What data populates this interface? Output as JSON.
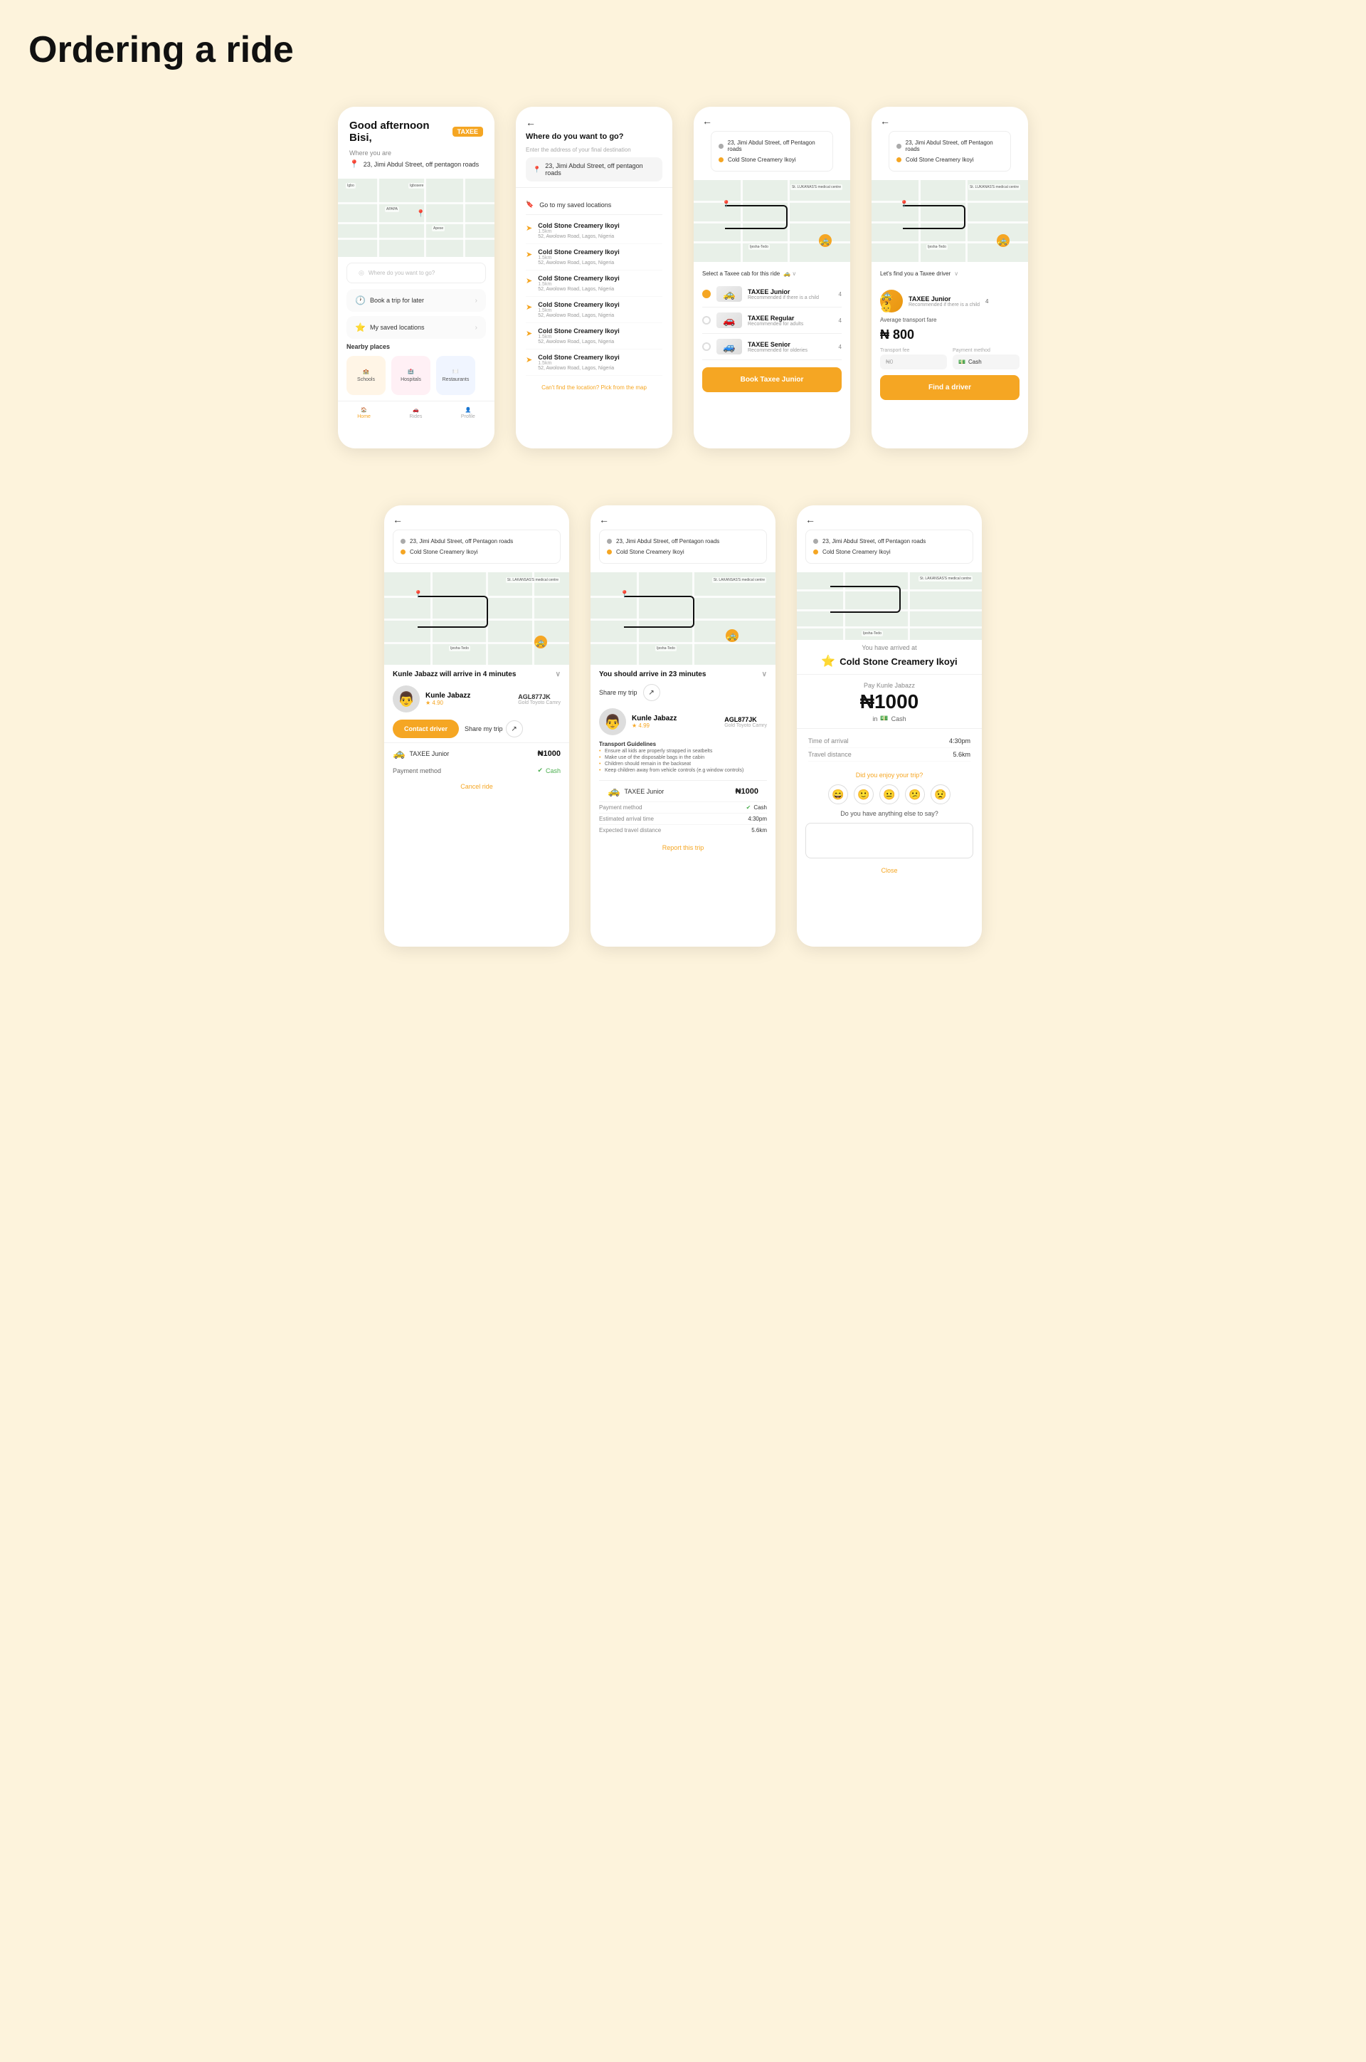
{
  "page": {
    "title": "Ordering a ride"
  },
  "screen1": {
    "greeting": "Good afternoon Bisi,",
    "badge": "TAXEE",
    "where_label": "Where you are",
    "location": "23, Jimi Abdul Street, off pentagon roads",
    "destination_placeholder": "Where do you want to go?",
    "option1_label": "Book a trip for later",
    "option2_label": "My saved locations",
    "nearby_label": "Nearby places",
    "nearby": [
      {
        "label": "Schools",
        "emoji": "🏫",
        "bg": "orange"
      },
      {
        "label": "Hospitals",
        "emoji": "🏥",
        "bg": "pink"
      },
      {
        "label": "Restaurants",
        "emoji": "🍽️",
        "bg": "blue"
      }
    ],
    "nav": [
      {
        "label": "Home",
        "emoji": "🏠",
        "active": true
      },
      {
        "label": "Rides",
        "emoji": "🚗",
        "active": false
      },
      {
        "label": "Profile",
        "emoji": "👤",
        "active": false
      }
    ]
  },
  "screen2": {
    "back": "←",
    "title": "Where do you want to go?",
    "subtitle": "Enter the address of your final destination",
    "input_value": "23, Jimi Abdul Street, off pentagon roads",
    "go_saved": "Go to my saved locations",
    "results": [
      {
        "name": "Cold Stone Creamery Ikoyi",
        "dist": "1.5km",
        "addr": "52, Awolowo Road, Lagos, Nigeria"
      },
      {
        "name": "Cold Stone Creamery Ikoyi",
        "dist": "1.5km",
        "addr": "52, Awolowo Road, Lagos, Nigeria"
      },
      {
        "name": "Cold Stone Creamery Ikoyi",
        "dist": "1.5km",
        "addr": "52, Awolowo Road, Lagos, Nigeria"
      },
      {
        "name": "Cold Stone Creamery Ikoyi",
        "dist": "1.5km",
        "addr": "52, Awolowo Road, Lagos, Nigeria"
      },
      {
        "name": "Cold Stone Creamery Ikoyi",
        "dist": "1.5km",
        "addr": "52, Awolowo Road, Lagos, Nigeria"
      },
      {
        "name": "Cold Stone Creamery Ikoyi",
        "dist": "1.5km",
        "addr": "52, Awolowo Road, Lagos, Nigeria"
      }
    ],
    "cant_find": "Can't find the location?",
    "pick_map": "Pick from the map"
  },
  "screen3": {
    "back": "←",
    "from": "23, Jimi Abdul Street, off Pentagon roads",
    "to": "Cold Stone Creamery Ikoyi",
    "select_cab_label": "Select a Taxee cab for this ride",
    "cab_options": [
      {
        "name": "TAXEE Junior",
        "desc": "Recommended if there is a child",
        "seats": "4",
        "selected": true
      },
      {
        "name": "TAXEE Regular",
        "desc": "Recommended for adults",
        "seats": "4",
        "selected": false
      },
      {
        "name": "TAXEE Senior",
        "desc": "Recommended for olderies",
        "seats": "4",
        "selected": false
      }
    ],
    "book_btn": "Book Taxee Junior"
  },
  "screen4": {
    "back": "←",
    "from": "23, Jimi Abdul Street, off Pentagon roads",
    "to": "Cold Stone Creamery Ikoyi",
    "find_driver_label": "Let's find you a Taxee driver",
    "driver": {
      "name": "TAXEE Junior",
      "desc": "Recommended if there is a child",
      "seats": "4",
      "emoji": "🚕"
    },
    "avg_fare_label": "Average transport fare",
    "fare": "₦ 800",
    "transport_field_label": "Transport fee",
    "transport_field_value": "₦0",
    "payment_label": "Payment method",
    "payment_value": "Cash",
    "find_btn": "Find a driver"
  },
  "screen5": {
    "back": "←",
    "from": "23, Jimi Abdul Street, off Pentagon roads",
    "to": "Cold Stone Creamery Ikoyi",
    "arrive_text": "Kunle Jabazz will arrive in 4 minutes",
    "driver": {
      "name": "Kunle Jabazz",
      "rating": "★ 4.90",
      "plate": "AGL877JK",
      "plate_sub": "Gold Toyoto Camry",
      "emoji": "👨"
    },
    "contact_btn": "Contact driver",
    "share_label": "Share my trip",
    "cab_name": "TAXEE Junior",
    "price": "₦1000",
    "payment_method": "Cash",
    "cancel_label": "Cancel ride"
  },
  "screen6": {
    "back": "←",
    "from": "23, Jimi Abdul Street, off Pentagon roads",
    "to": "Cold Stone Creamery Ikoyi",
    "arrive_text": "You should arrive in 23 minutes",
    "driver": {
      "name": "Kunle Jabazz",
      "rating": "★ 4.99",
      "plate": "AGL877JK",
      "plate_sub": "Gold Toyoto Camry",
      "emoji": "👨"
    },
    "share_label": "Share my trip",
    "cab_name": "TAXEE Junior",
    "price": "₦1000",
    "guidelines_title": "Transport Guidelines",
    "guidelines": [
      "Ensure all kids are properly strapped in seatbelts",
      "Make use of the disposable bags in the cabin",
      "Children should remain in the backseat",
      "Keep children away from vehicle controls (e.g window controls)"
    ],
    "payment_label": "Payment method",
    "payment_value": "Cash",
    "eta_label": "Estimated arrival time",
    "eta_value": "4:30pm",
    "distance_label": "Expected travel distance",
    "distance_value": "5.6km",
    "report_label": "Report this trip"
  },
  "screen7": {
    "back": "←",
    "from": "23, Jimi Abdul Street, off Pentagon roads",
    "to": "Cold Stone Creamery Ikoyi",
    "arrived_label": "You have arrived at",
    "destination": "Cold Stone Creamery Ikoyi",
    "pay_label": "Pay Kunle Jabazz",
    "amount": "₦1000",
    "in_label": "in",
    "payment_method": "Cash",
    "arrival_label": "Time of arrival",
    "arrival_value": "4:30pm",
    "distance_label": "Travel distance",
    "distance_value": "5.6km",
    "rating_label": "Did you enjoy your trip?",
    "rating_emojis": [
      "😄",
      "🙂",
      "😐",
      "😕",
      "😟"
    ],
    "feedback_label": "Do you have anything else to say?",
    "close_label": "Close"
  }
}
